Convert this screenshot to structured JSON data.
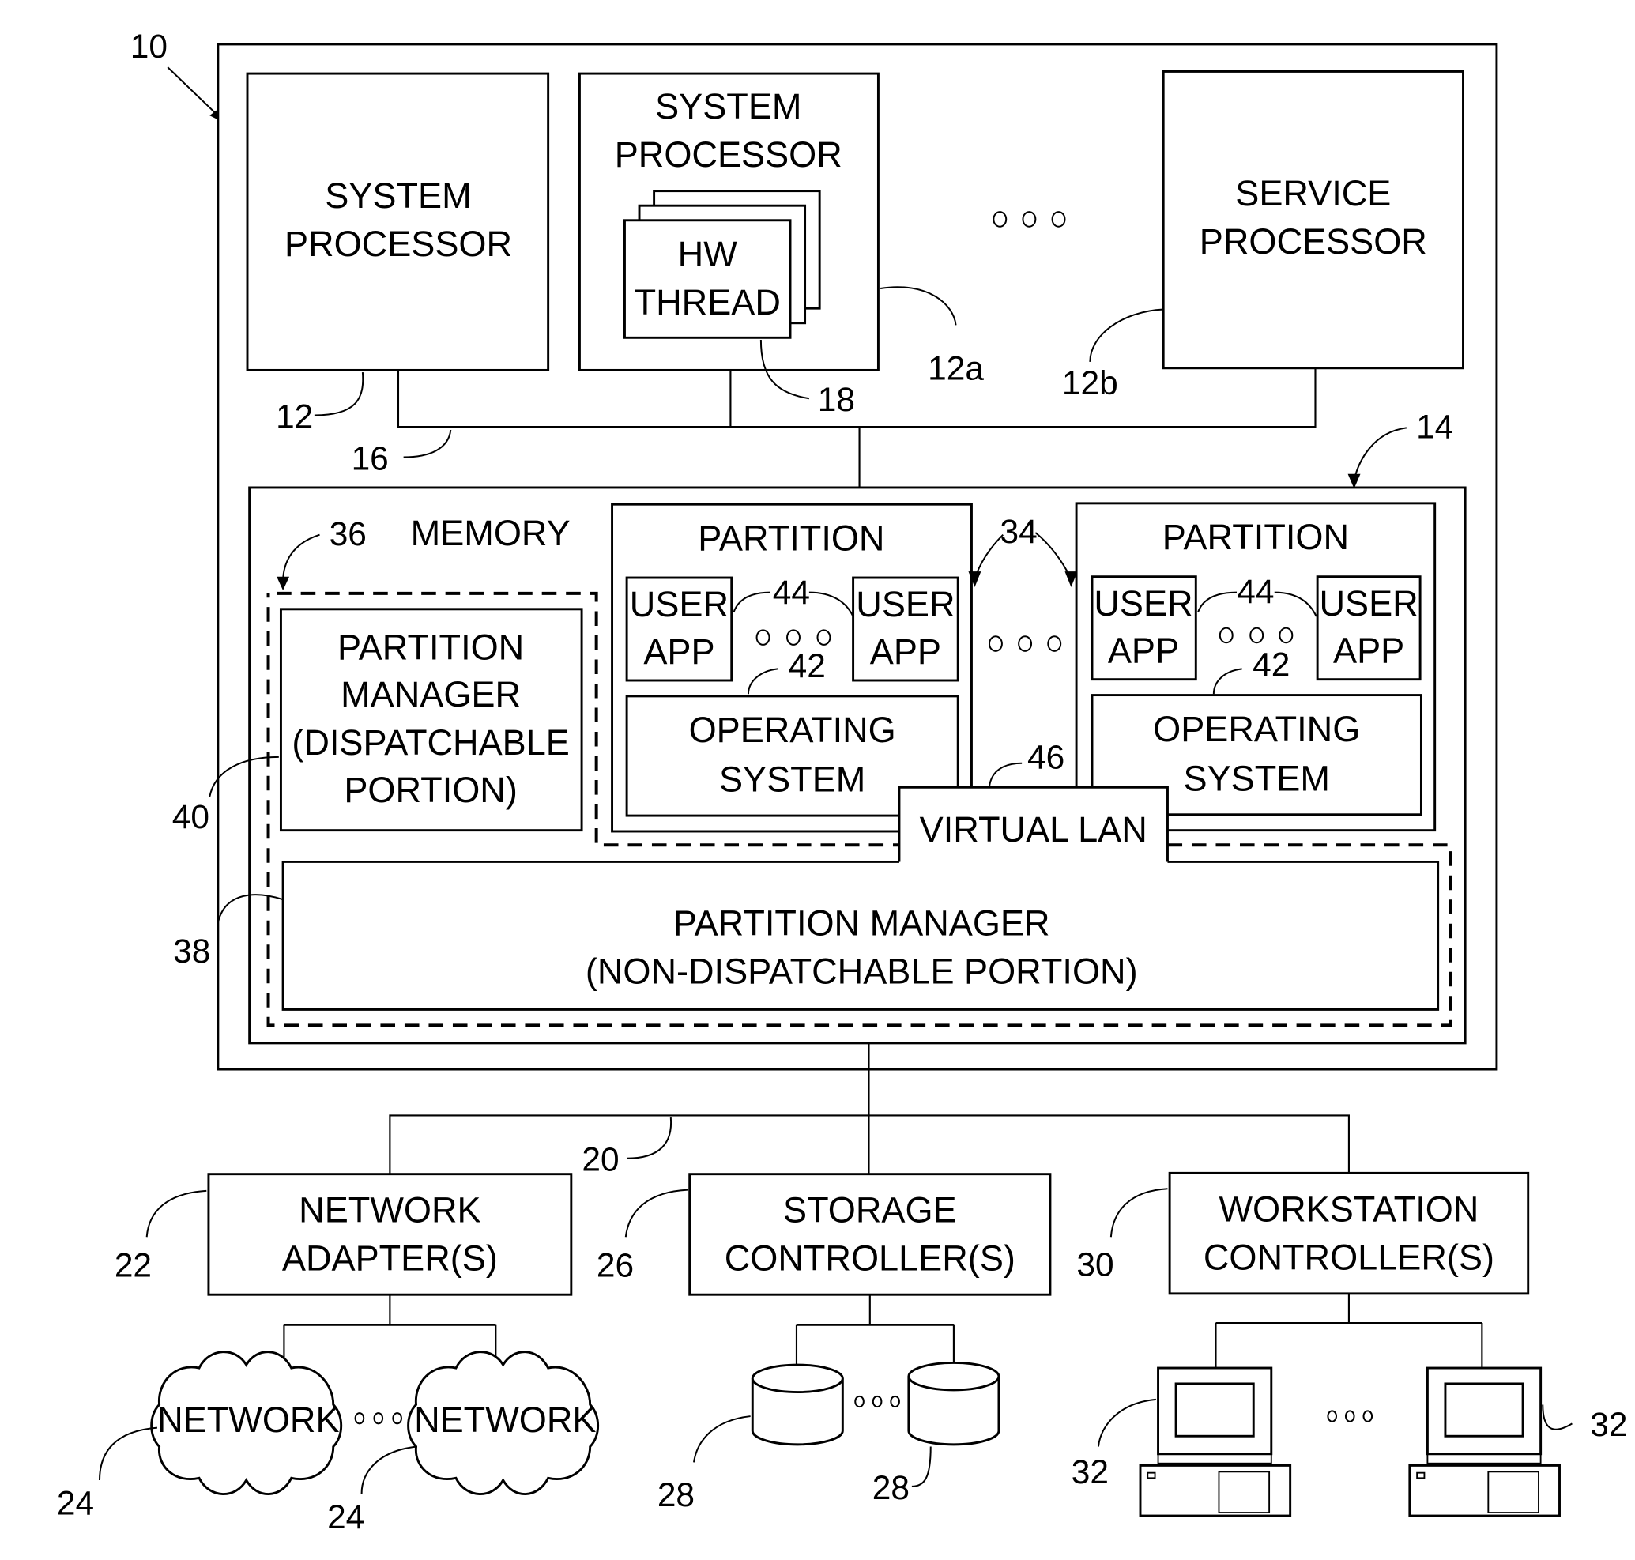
{
  "figure": {
    "system_ref": "10",
    "processors": [
      {
        "ref": "12",
        "lines": [
          "SYSTEM",
          "PROCESSOR"
        ]
      },
      {
        "ref": "12a",
        "lines": [
          "SYSTEM",
          "PROCESSOR"
        ],
        "hw_thread": {
          "ref": "18",
          "lines": [
            "HW",
            "THREAD"
          ]
        }
      },
      {
        "ref": "12b",
        "lines": [
          "SERVICE",
          "PROCESSOR"
        ]
      }
    ],
    "processor_bus_ref": "16",
    "memory": {
      "ref": "14",
      "label": "MEMORY",
      "partition_manager_group_ref": "36",
      "dispatchable": {
        "ref": "40",
        "lines": [
          "PARTITION",
          "MANAGER",
          "(DISPATCHABLE",
          "PORTION)"
        ]
      },
      "non_dispatchable": {
        "ref": "38",
        "lines": [
          "PARTITION MANAGER",
          "(NON-DISPATCHABLE PORTION)"
        ]
      },
      "partitions_ref": "34",
      "partitions": [
        {
          "label": "PARTITION",
          "apps": [
            "USER APP",
            "USER APP"
          ],
          "apps_ref": "44",
          "os_lines": [
            "OPERATING",
            "SYSTEM"
          ],
          "os_ref": "42"
        },
        {
          "label": "PARTITION",
          "apps": [
            "USER APP",
            "USER APP"
          ],
          "apps_ref": "44",
          "os_lines": [
            "OPERATING",
            "SYSTEM"
          ],
          "os_ref": "42"
        }
      ],
      "virtual_lan": {
        "ref": "46",
        "label": "VIRTUAL LAN"
      }
    },
    "io_bus_ref": "20",
    "controllers": [
      {
        "ref": "22",
        "lines": [
          "NETWORK",
          "ADAPTER(S)"
        ]
      },
      {
        "ref": "26",
        "lines": [
          "STORAGE",
          "CONTROLLER(S)"
        ]
      },
      {
        "ref": "30",
        "lines": [
          "WORKSTATION",
          "CONTROLLER(S)"
        ]
      }
    ],
    "networks": [
      {
        "ref": "24",
        "label": "NETWORK"
      },
      {
        "ref": "24",
        "label": "NETWORK"
      }
    ],
    "disks": [
      {
        "ref": "28"
      },
      {
        "ref": "28"
      }
    ],
    "workstations": [
      {
        "ref": "32"
      },
      {
        "ref": "32"
      }
    ],
    "ellipsis_icon": "three-circles"
  }
}
